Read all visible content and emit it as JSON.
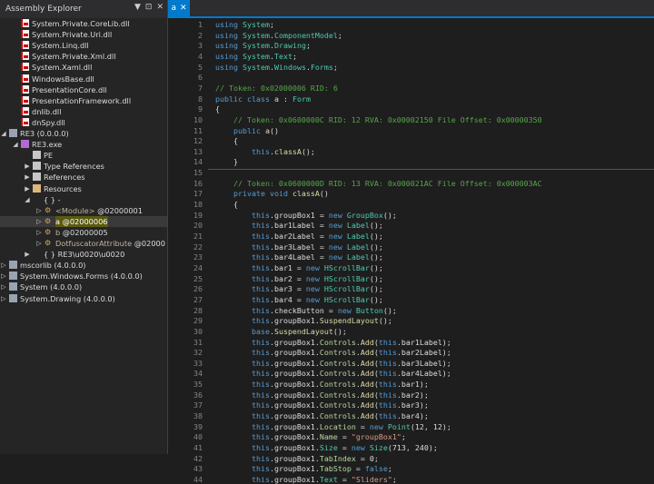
{
  "assembly_explorer": {
    "title": "Assembly Explorer",
    "controls": [
      "▼",
      "⊡",
      "✕"
    ],
    "items": [
      {
        "label": "System.Private.CoreLib.dll",
        "icon": "dll-icon",
        "depth": 1
      },
      {
        "label": "System.Private.Uri.dll",
        "icon": "dll-icon",
        "depth": 1
      },
      {
        "label": "System.Linq.dll",
        "icon": "dll-icon",
        "depth": 1
      },
      {
        "label": "System.Private.Xml.dll",
        "icon": "dll-icon",
        "depth": 1
      },
      {
        "label": "System.Xaml.dll",
        "icon": "dll-icon",
        "depth": 1
      },
      {
        "label": "WindowsBase.dll",
        "icon": "dll-icon",
        "depth": 1
      },
      {
        "label": "PresentationCore.dll",
        "icon": "dll-icon",
        "depth": 1
      },
      {
        "label": "PresentationFramework.dll",
        "icon": "dll-icon",
        "depth": 1
      },
      {
        "label": "dnlib.dll",
        "icon": "dll-icon",
        "depth": 1
      },
      {
        "label": "dnSpy.dll",
        "icon": "dll-icon",
        "depth": 1
      },
      {
        "label": "RE3",
        "label2": "(0.0.0.0)",
        "icon": "assembly-icon",
        "depth": 0,
        "arrow": "◢"
      },
      {
        "label": "RE3.exe",
        "icon": "module-icon",
        "depth": 1,
        "arrow": "◢"
      },
      {
        "label": "PE",
        "icon": "pe-icon",
        "depth": 2
      },
      {
        "label": "Type References",
        "icon": "references-icon",
        "depth": 2,
        "arrow": "▶"
      },
      {
        "label": "References",
        "icon": "references-icon",
        "depth": 2,
        "arrow": "▶"
      },
      {
        "label": "Resources",
        "icon": "folder-icon",
        "depth": 2,
        "arrow": "▶"
      },
      {
        "label": "{ }",
        "label2": "-",
        "icon": "namespace-icon",
        "depth": 2,
        "arrow": "◢"
      },
      {
        "label": "<Module>",
        "label2": "@02000001",
        "icon": "class-icon",
        "depth": 3,
        "arrow": "▷"
      },
      {
        "label": "a",
        "label2": "@02000006",
        "icon": "class-icon",
        "depth": 3,
        "arrow": "▷",
        "selected": true
      },
      {
        "label": "b",
        "label2": "@02000005",
        "icon": "class-icon",
        "depth": 3,
        "arrow": "▷"
      },
      {
        "label": "DotfuscatorAttribute",
        "label2": "@02000",
        "icon": "class-icon",
        "depth": 3,
        "arrow": "▷"
      },
      {
        "label": "{ }",
        "label2": "RE3\\u0020\\u0020",
        "icon": "namespace-icon",
        "depth": 2,
        "arrow": "▶"
      },
      {
        "label": "mscorlib (4.0.0.0)",
        "icon": "assembly-icon",
        "depth": 0,
        "arrow": "▷"
      },
      {
        "label": "System.Windows.Forms (4.0.0.0)",
        "icon": "assembly-icon",
        "depth": 0,
        "arrow": "▷"
      },
      {
        "label": "System (4.0.0.0)",
        "icon": "assembly-icon",
        "depth": 0,
        "arrow": "▷"
      },
      {
        "label": "System.Drawing (4.0.0.0)",
        "icon": "assembly-icon",
        "depth": 0,
        "arrow": "▷"
      }
    ]
  },
  "tab": {
    "label": "a",
    "close": "✕"
  },
  "code": {
    "lines": [
      {
        "n": "1",
        "t": "using System;"
      },
      {
        "n": "2",
        "t": "using System.ComponentModel;"
      },
      {
        "n": "3",
        "t": "using System.Drawing;"
      },
      {
        "n": "4",
        "t": "using System.Text;"
      },
      {
        "n": "5",
        "t": "using System.Windows.Forms;"
      },
      {
        "n": "6",
        "t": ""
      },
      {
        "n": "7",
        "t": "// Token: 0x02000006 RID: 6"
      },
      {
        "n": "8",
        "t": "public class a : Form"
      },
      {
        "n": "9",
        "t": "{"
      },
      {
        "n": "10",
        "t": "    // Token: 0x0600000C RID: 12 RVA: 0x00002150 File Offset: 0x00000350"
      },
      {
        "n": "11",
        "t": "    public a()"
      },
      {
        "n": "12",
        "t": "    {"
      },
      {
        "n": "13",
        "t": "        this.classA();"
      },
      {
        "n": "14",
        "t": "    }"
      },
      {
        "n": "15",
        "t": ""
      },
      {
        "n": "16",
        "t": "    // Token: 0x0600000D RID: 13 RVA: 0x000021AC File Offset: 0x000003AC"
      },
      {
        "n": "17",
        "t": "    private void classA()"
      },
      {
        "n": "18",
        "t": "    {"
      },
      {
        "n": "19",
        "t": "        this.groupBox1 = new GroupBox();"
      },
      {
        "n": "20",
        "t": "        this.bar1Label = new Label();"
      },
      {
        "n": "21",
        "t": "        this.bar2Label = new Label();"
      },
      {
        "n": "22",
        "t": "        this.bar3Label = new Label();"
      },
      {
        "n": "23",
        "t": "        this.bar4Label = new Label();"
      },
      {
        "n": "24",
        "t": "        this.bar1 = new HScrollBar();"
      },
      {
        "n": "25",
        "t": "        this.bar2 = new HScrollBar();"
      },
      {
        "n": "26",
        "t": "        this.bar3 = new HScrollBar();"
      },
      {
        "n": "27",
        "t": "        this.bar4 = new HScrollBar();"
      },
      {
        "n": "28",
        "t": "        this.checkButton = new Button();"
      },
      {
        "n": "29",
        "t": "        this.groupBox1.SuspendLayout();"
      },
      {
        "n": "30",
        "t": "        base.SuspendLayout();"
      },
      {
        "n": "31",
        "t": "        this.groupBox1.Controls.Add(this.bar1Label);"
      },
      {
        "n": "32",
        "t": "        this.groupBox1.Controls.Add(this.bar2Label);"
      },
      {
        "n": "33",
        "t": "        this.groupBox1.Controls.Add(this.bar3Label);"
      },
      {
        "n": "34",
        "t": "        this.groupBox1.Controls.Add(this.bar4Label);"
      },
      {
        "n": "35",
        "t": "        this.groupBox1.Controls.Add(this.bar1);"
      },
      {
        "n": "36",
        "t": "        this.groupBox1.Controls.Add(this.bar2);"
      },
      {
        "n": "37",
        "t": "        this.groupBox1.Controls.Add(this.bar3);"
      },
      {
        "n": "38",
        "t": "        this.groupBox1.Controls.Add(this.bar4);"
      },
      {
        "n": "39",
        "t": "        this.groupBox1.Location = new Point(12, 12);"
      },
      {
        "n": "40",
        "t": "        this.groupBox1.Name = \"groupBox1\";"
      },
      {
        "n": "41",
        "t": "        this.groupBox1.Size = new Size(713, 240);"
      },
      {
        "n": "42",
        "t": "        this.groupBox1.TabIndex = 0;"
      },
      {
        "n": "43",
        "t": "        this.groupBox1.TabStop = false;"
      },
      {
        "n": "44",
        "t": "        this.groupBox1.Text = \"Sliders\";"
      }
    ]
  }
}
